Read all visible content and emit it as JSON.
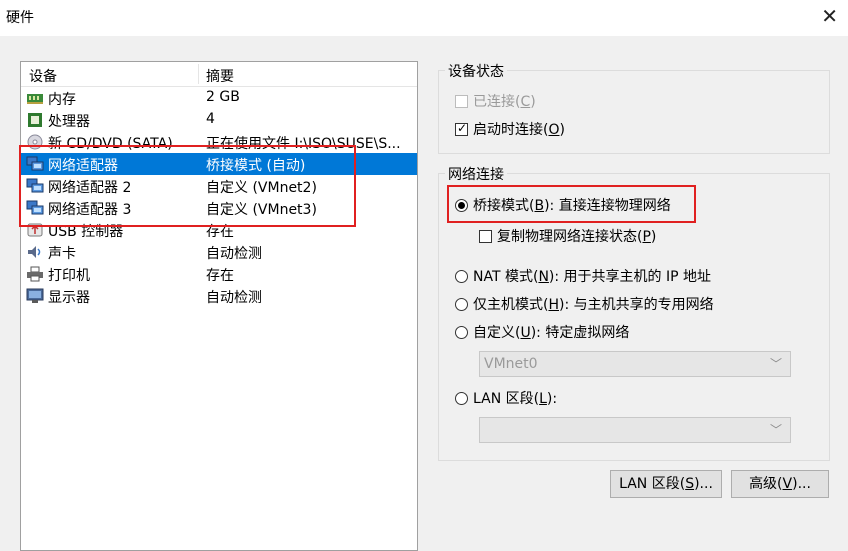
{
  "window": {
    "title": "硬件",
    "close_glyph": "✕"
  },
  "device_list": {
    "columns": [
      "设备",
      "摘要"
    ],
    "rows": [
      {
        "icon": "memory-icon",
        "name": "内存",
        "summary": "2 GB"
      },
      {
        "icon": "processor-icon",
        "name": "处理器",
        "summary": "4"
      },
      {
        "icon": "cd-dvd-icon",
        "name": "新 CD/DVD (SATA)",
        "summary": "正在使用文件 I:\\ISO\\SUSE\\S..."
      },
      {
        "icon": "network-adapter-icon",
        "name": "网络适配器",
        "summary": "桥接模式 (自动)",
        "selected": true
      },
      {
        "icon": "network-adapter-icon",
        "name": "网络适配器 2",
        "summary": "自定义 (VMnet2)"
      },
      {
        "icon": "network-adapter-icon",
        "name": "网络适配器 3",
        "summary": "自定义 (VMnet3)"
      },
      {
        "icon": "usb-icon",
        "name": "USB 控制器",
        "summary": "存在"
      },
      {
        "icon": "sound-card-icon",
        "name": "声卡",
        "summary": "自动检测"
      },
      {
        "icon": "printer-icon",
        "name": "打印机",
        "summary": "存在"
      },
      {
        "icon": "display-icon",
        "name": "显示器",
        "summary": "自动检测"
      }
    ]
  },
  "device_status": {
    "label": "设备状态",
    "connected": {
      "text": "已连接(",
      "key": "C",
      "end": ")",
      "checked": false,
      "disabled": true
    },
    "connect_at_power_on": {
      "text": "启动时连接(",
      "key": "O",
      "end": ")",
      "checked": true
    }
  },
  "network_connection": {
    "label": "网络连接",
    "bridged": {
      "text": "桥接模式(",
      "key": "B",
      "end": "): 直接连接物理网络",
      "selected": true
    },
    "replicate": {
      "text": "复制物理网络连接状态(",
      "key": "P",
      "end": ")",
      "checked": false
    },
    "nat": {
      "text": "NAT 模式(",
      "key": "N",
      "end": "): 用于共享主机的 IP 地址",
      "selected": false
    },
    "host_only": {
      "text": "仅主机模式(",
      "key": "H",
      "end": "): 与主机共享的专用网络",
      "selected": false
    },
    "custom": {
      "text": "自定义(",
      "key": "U",
      "end": "): 特定虚拟网络",
      "selected": false
    },
    "custom_value": "VMnet0",
    "lan_segment": {
      "text": "LAN 区段(",
      "key": "L",
      "end": "):",
      "selected": false
    },
    "lan_value": ""
  },
  "buttons": {
    "lan_segments": {
      "text": "LAN 区段(",
      "key": "S",
      "end": ")..."
    },
    "advanced": {
      "text": "高级(",
      "key": "V",
      "end": ")..."
    }
  },
  "colors": {
    "selection": "#0078d7",
    "highlight_box": "#e02020"
  }
}
